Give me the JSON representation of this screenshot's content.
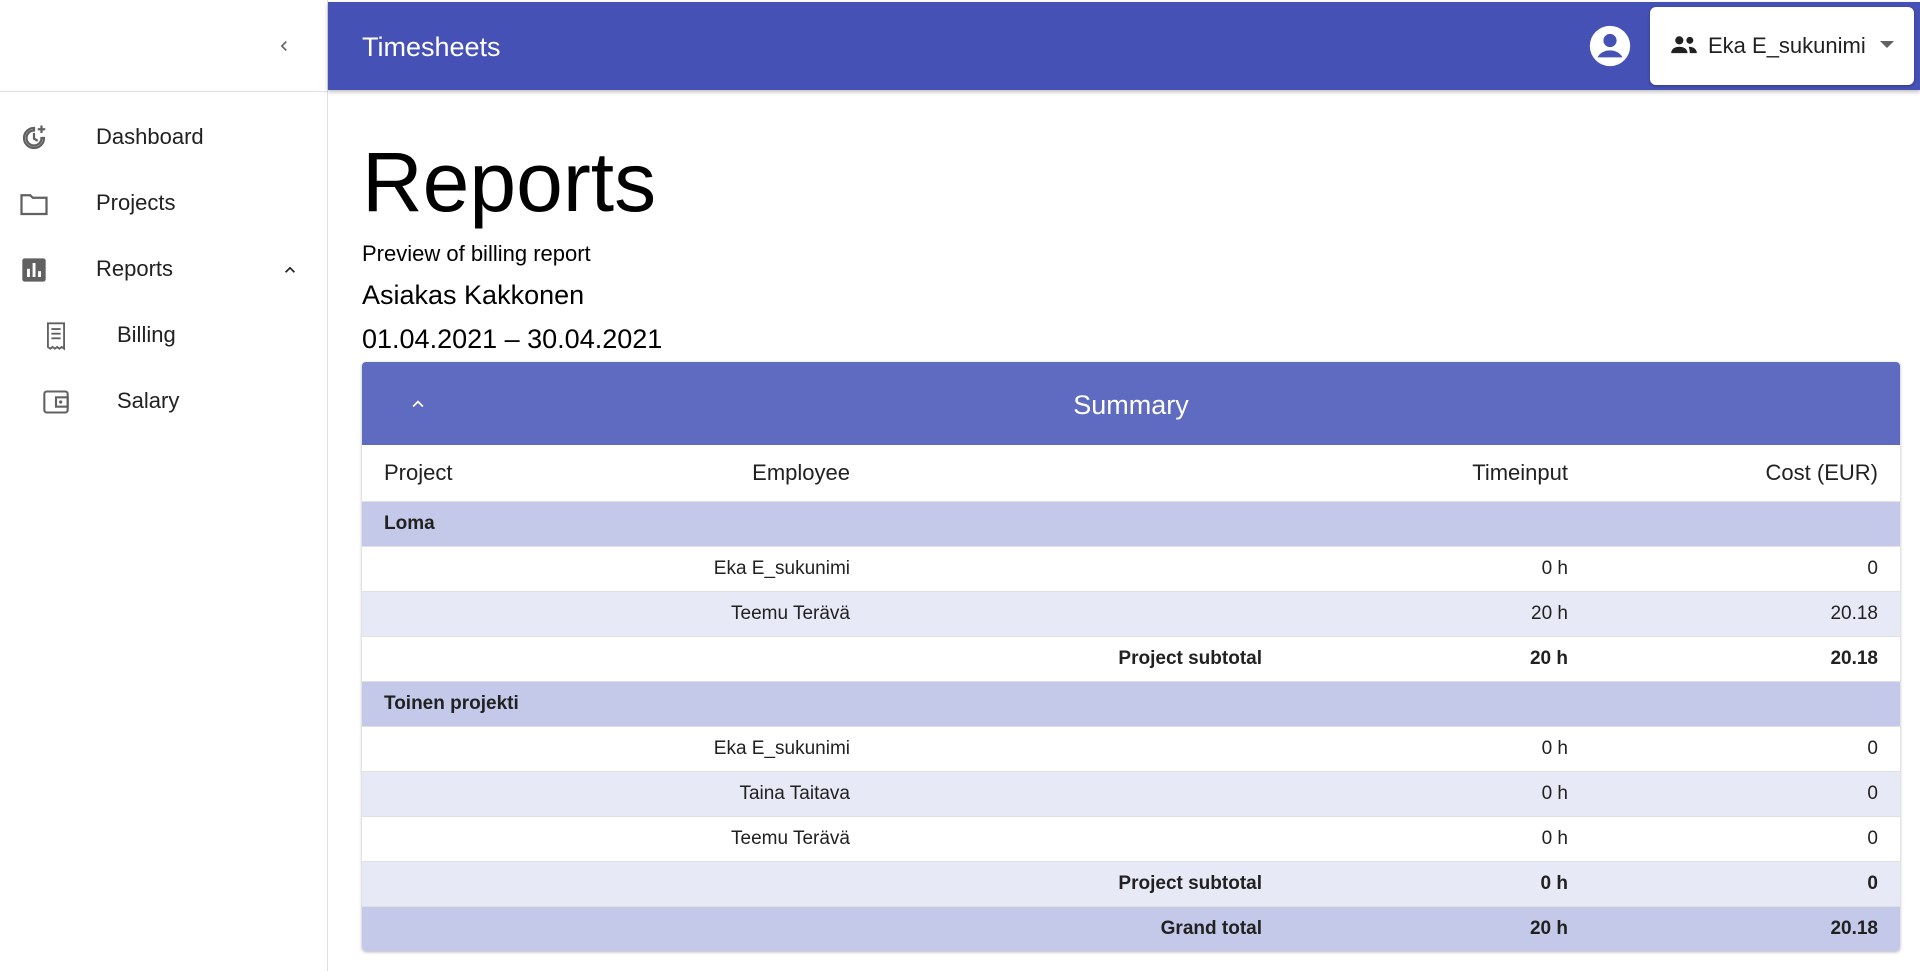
{
  "appbar": {
    "title": "Timesheets",
    "user": "Eka E_sukunimi"
  },
  "sidebar": {
    "items": [
      {
        "label": "Dashboard",
        "icon": "dashboard-icon"
      },
      {
        "label": "Projects",
        "icon": "folder-icon"
      },
      {
        "label": "Reports",
        "icon": "bar-chart-icon"
      },
      {
        "label": "Billing",
        "icon": "receipt-icon"
      },
      {
        "label": "Salary",
        "icon": "wallet-icon"
      }
    ]
  },
  "page": {
    "title": "Reports",
    "subtitle": "Preview of billing report",
    "client": "Asiakas Kakkonen",
    "period": "01.04.2021 – 30.04.2021"
  },
  "summary": {
    "title": "Summary",
    "headers": {
      "project": "Project",
      "employee": "Employee",
      "timeinput": "Timeinput",
      "cost": "Cost (EUR)"
    },
    "groups": [
      {
        "name": "Loma",
        "rows": [
          {
            "employee": "Eka E_sukunimi",
            "time": "0 h",
            "cost": "0"
          },
          {
            "employee": "Teemu Terävä",
            "time": "20 h",
            "cost": "20.18"
          }
        ],
        "subtotal": {
          "label": "Project subtotal",
          "time": "20 h",
          "cost": "20.18"
        }
      },
      {
        "name": "Toinen projekti",
        "rows": [
          {
            "employee": "Eka E_sukunimi",
            "time": "0 h",
            "cost": "0"
          },
          {
            "employee": "Taina Taitava",
            "time": "0 h",
            "cost": "0"
          },
          {
            "employee": "Teemu Terävä",
            "time": "0 h",
            "cost": "0"
          }
        ],
        "subtotal": {
          "label": "Project subtotal",
          "time": "0 h",
          "cost": "0"
        }
      }
    ],
    "grand_total": {
      "label": "Grand total",
      "time": "20 h",
      "cost": "20.18"
    }
  },
  "colors": {
    "appbar": "#4651b5",
    "card_header": "#5f6bc0",
    "group_row": "#c5c9e9",
    "alt_row": "#e8e9f6"
  }
}
